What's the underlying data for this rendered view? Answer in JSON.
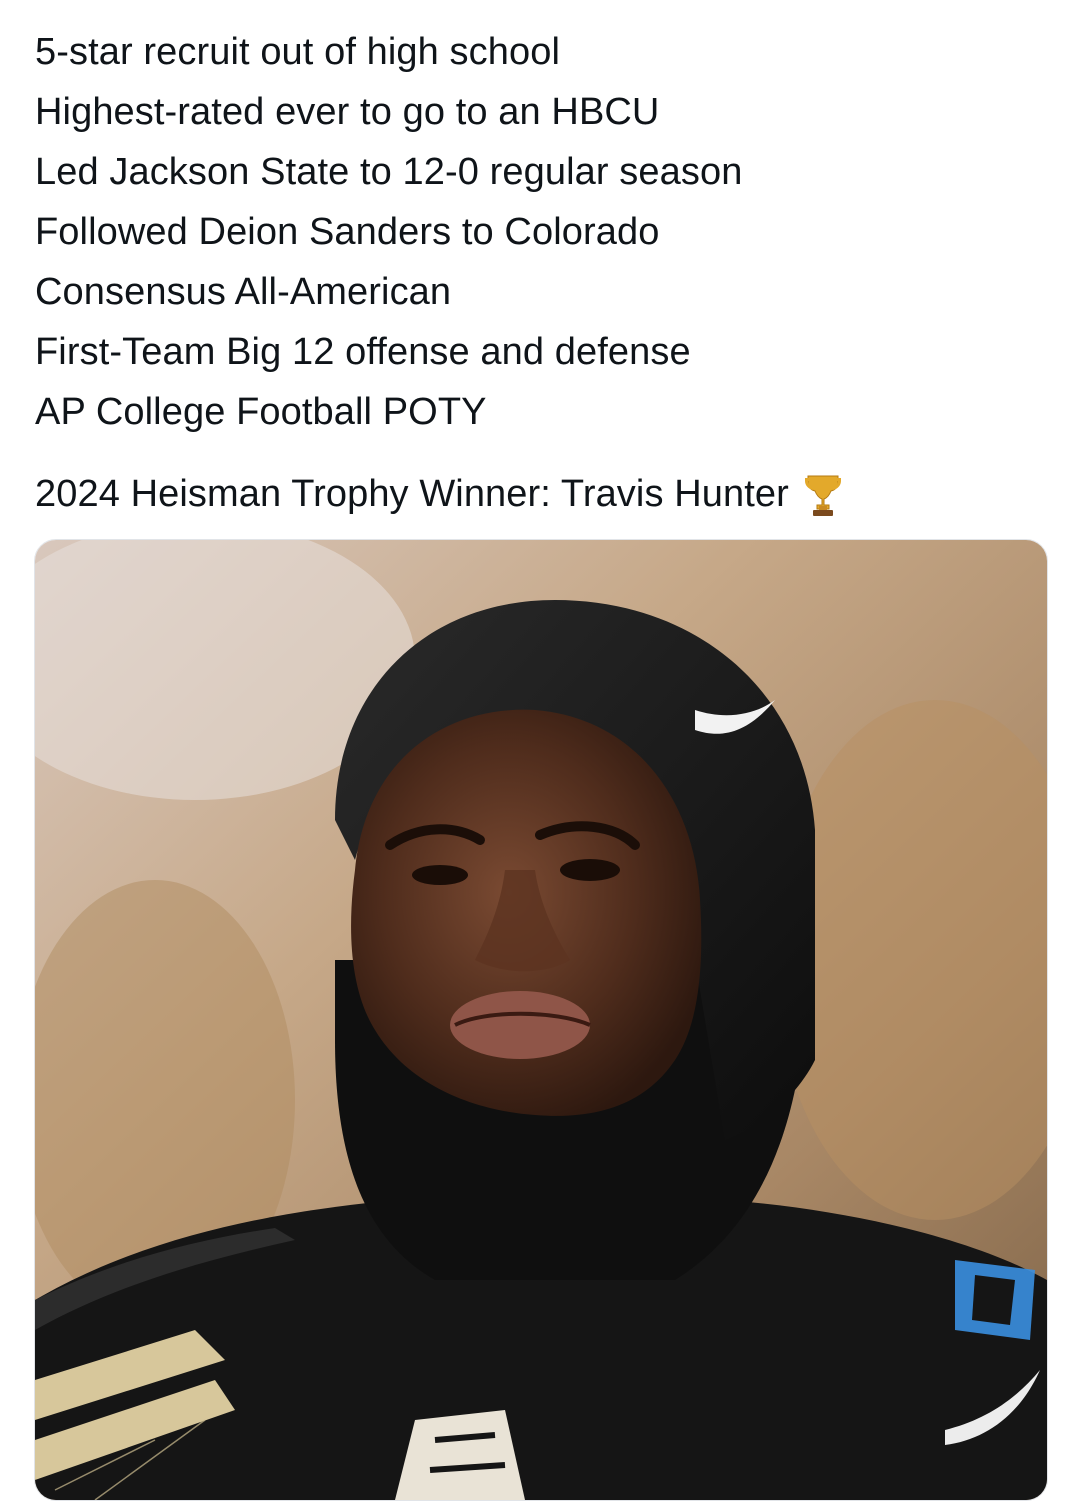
{
  "post": {
    "lines": [
      "5-star recruit out of high school",
      "Highest-rated ever to go to an HBCU",
      "Led Jackson State to 12-0 regular season",
      "Followed Deion Sanders to Colorado",
      "Consensus All-American",
      "First-Team Big 12 offense and defense",
      "AP College Football POTY"
    ],
    "headline": "2024 Heisman Trophy Winner: Travis Hunter",
    "headline_icon": "trophy-emoji"
  },
  "media": {
    "type": "photo",
    "icon_names": [
      "nike-swoosh",
      "big-12-logo"
    ],
    "jersey_number": "0",
    "colors": {
      "background_warm": "#c9a27a",
      "jersey_black": "#141414",
      "jersey_gold": "#cfb87c",
      "number_blue": "#3a8fe0"
    }
  }
}
